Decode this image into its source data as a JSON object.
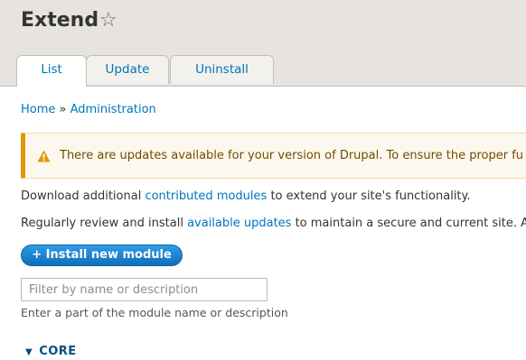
{
  "header": {
    "title": "Extend",
    "star_icon": "star-outline-icon"
  },
  "tabs": [
    {
      "label": "List",
      "active": true
    },
    {
      "label": "Update",
      "active": false
    },
    {
      "label": "Uninstall",
      "active": false
    }
  ],
  "breadcrumb": {
    "items": [
      "Home",
      "Administration"
    ],
    "separator": "»"
  },
  "messages": {
    "warning_icon": "warning-triangle-icon",
    "warning": "There are updates available for your version of Drupal. To ensure the proper fu"
  },
  "content": {
    "para1_pre": "Download additional ",
    "para1_link": "contributed modules",
    "para1_post": " to extend your site's functionality.",
    "para2_pre": "Regularly review and install ",
    "para2_link": "available updates",
    "para2_post": " to maintain a secure and current site. A",
    "install_button": "+ Install new module"
  },
  "filter": {
    "placeholder": "Filter by name or description",
    "value": "",
    "help": "Enter a part of the module name or description"
  },
  "packages": [
    {
      "label": "CORE",
      "expanded": true
    }
  ],
  "colors": {
    "link": "#0074bd",
    "button": "#1b86d2",
    "warning_border": "#e09600",
    "header_bg": "#e7e4df"
  }
}
